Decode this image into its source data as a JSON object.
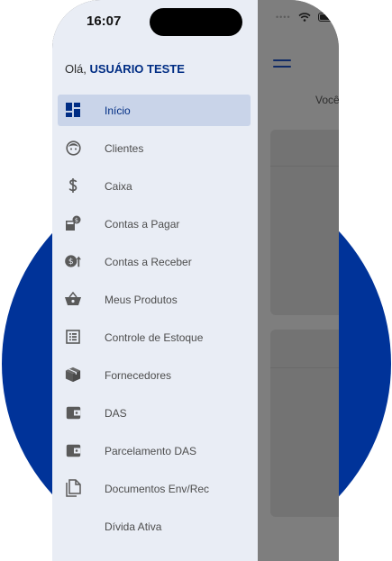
{
  "status_bar": {
    "time": "16:07"
  },
  "drawer": {
    "greeting_prefix": "Olá,",
    "user_name": "USUÁRIO TESTE",
    "menu": [
      {
        "label": "Início",
        "icon": "dashboard-icon",
        "active": true
      },
      {
        "label": "Clientes",
        "icon": "face-icon"
      },
      {
        "label": "Caixa",
        "icon": "dollar-icon"
      },
      {
        "label": "Contas a Pagar",
        "icon": "calculator-money-icon"
      },
      {
        "label": "Contas a Receber",
        "icon": "money-arrow-up-icon"
      },
      {
        "label": "Meus Produtos",
        "icon": "basket-icon"
      },
      {
        "label": "Controle de Estoque",
        "icon": "list-icon"
      },
      {
        "label": "Fornecedores",
        "icon": "box-icon"
      },
      {
        "label": "DAS",
        "icon": "wallet-icon"
      },
      {
        "label": "Parcelamento DAS",
        "icon": "wallet-icon"
      },
      {
        "label": "Documentos Env/Rec",
        "icon": "documents-icon"
      },
      {
        "label": "Dívida Ativa",
        "icon": "document-icon"
      }
    ]
  },
  "background_app": {
    "welcome_text": "Você"
  },
  "colors": {
    "brand_blue": "#003399",
    "active_bg": "#c9d4e9",
    "drawer_bg": "#e9edf5"
  }
}
